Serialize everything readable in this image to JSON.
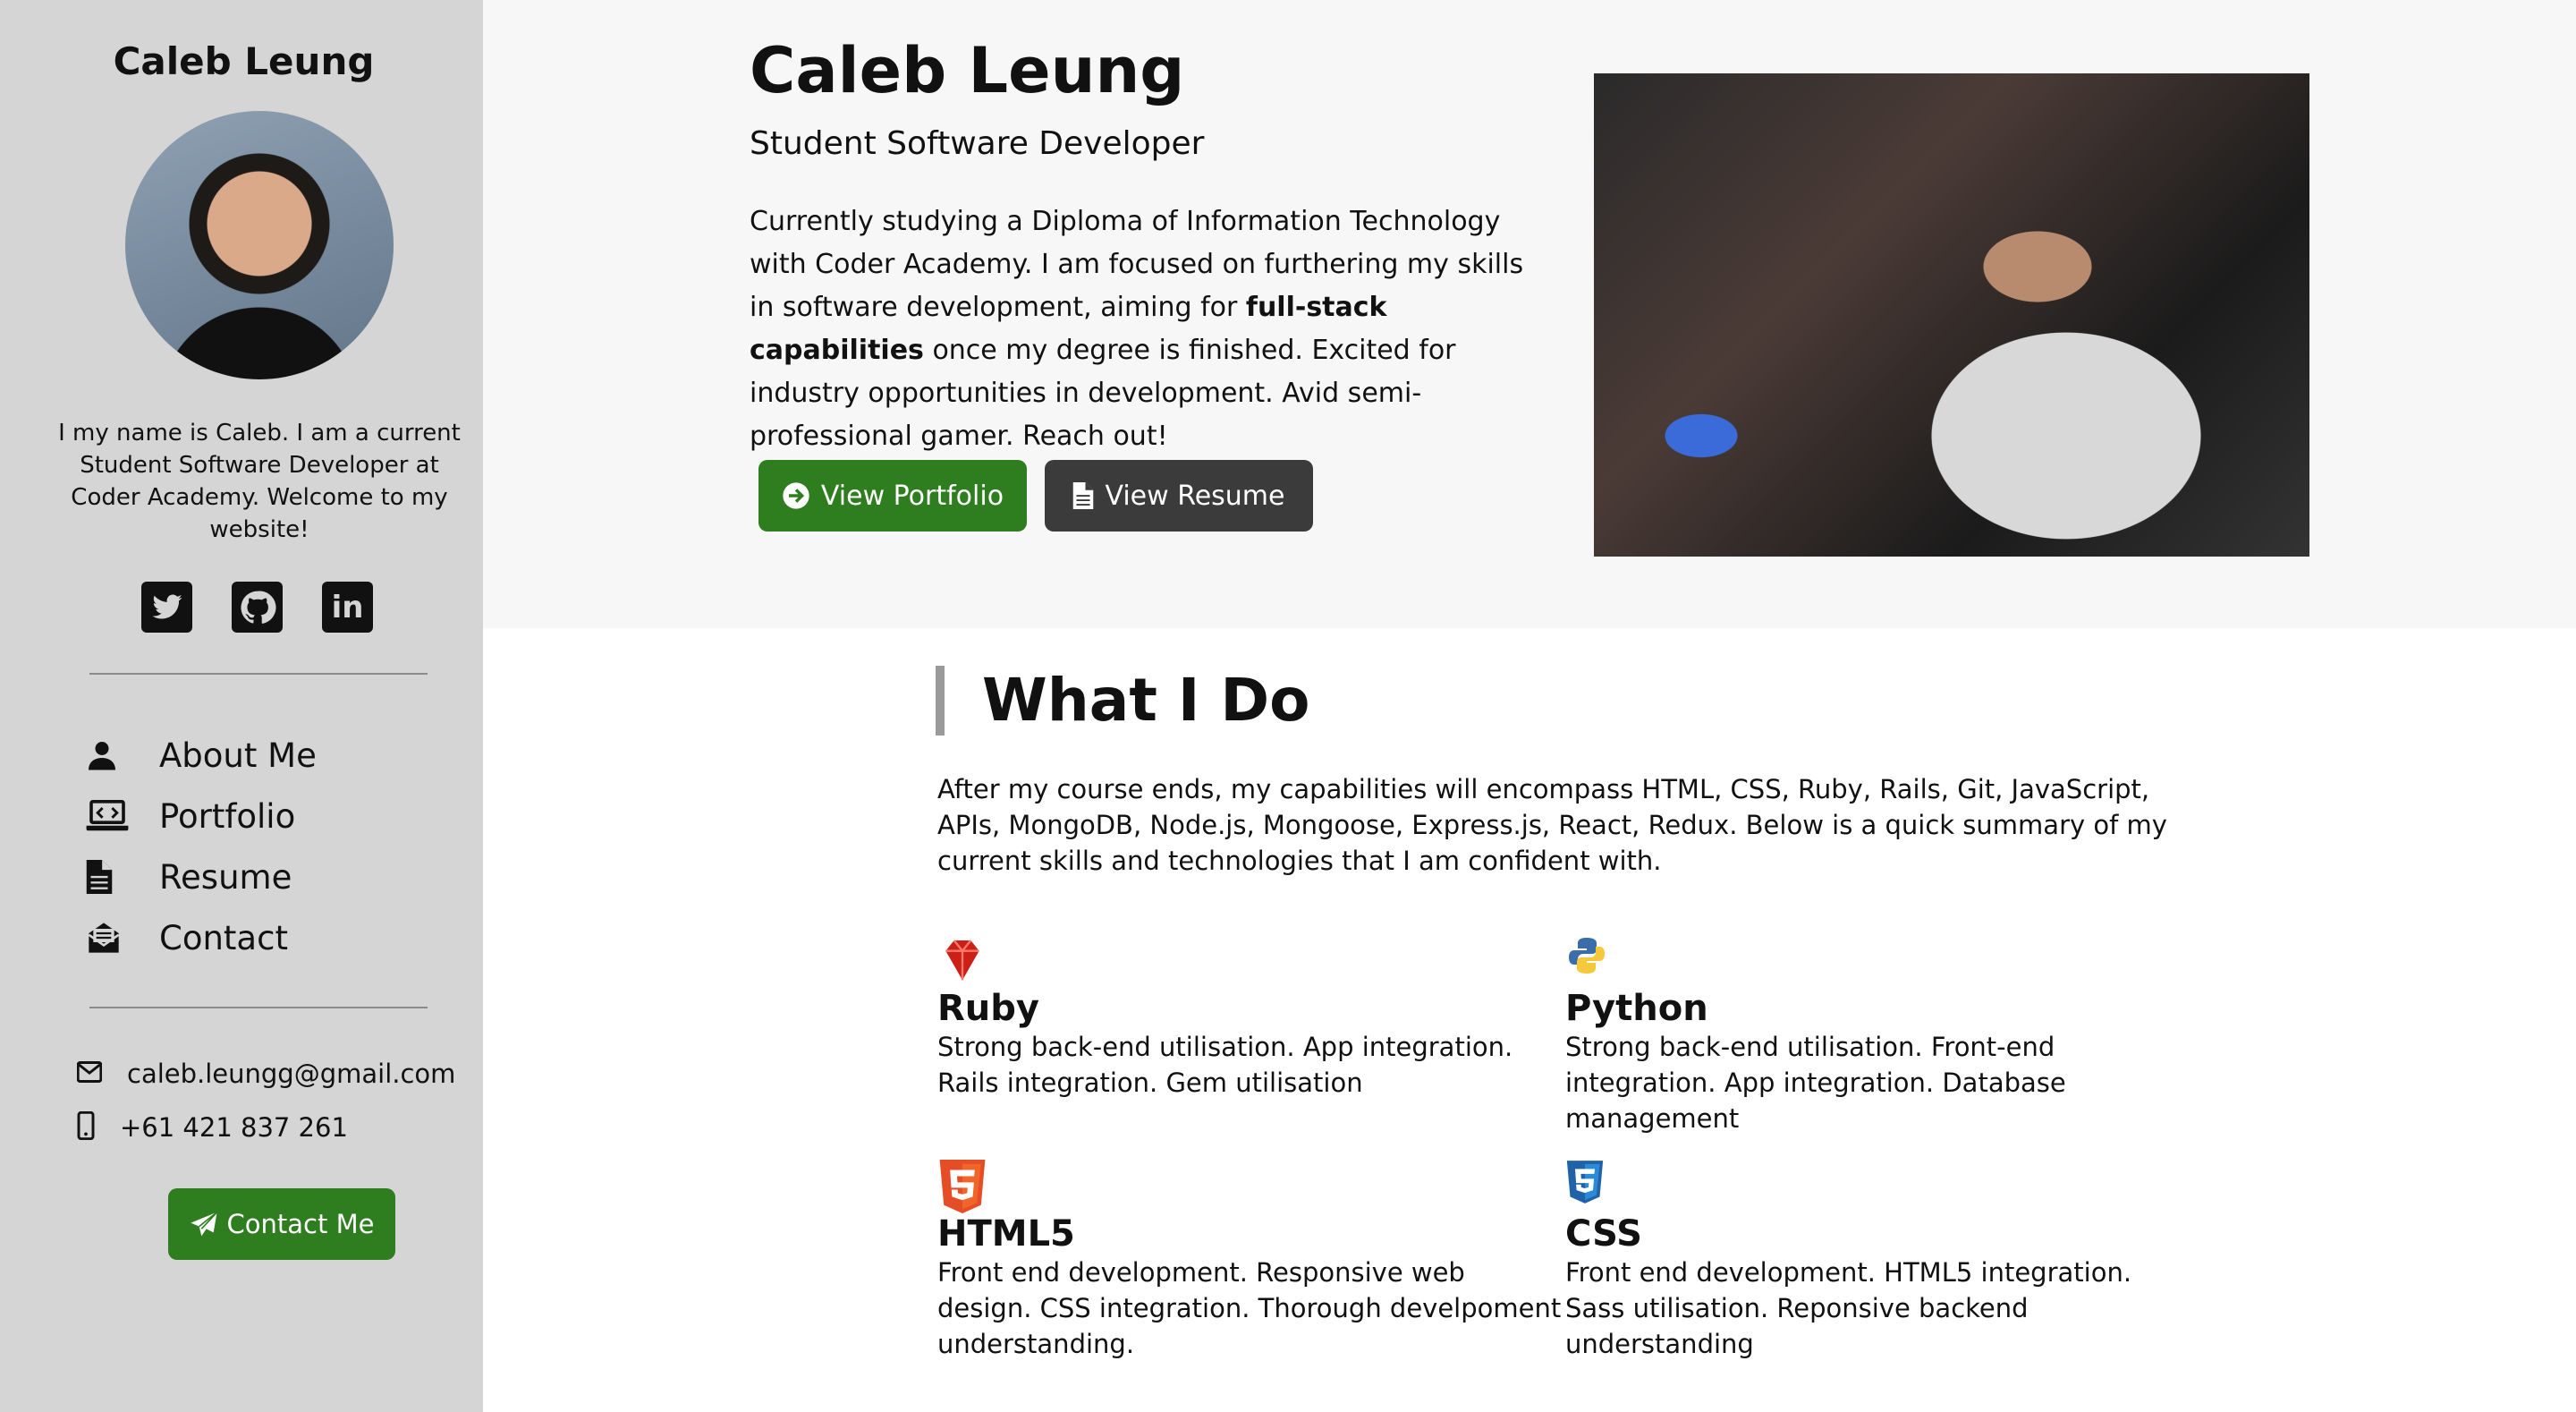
{
  "sidebar": {
    "name": "Caleb Leung",
    "intro": "I my name is Caleb. I am a current Student Software Developer at Coder Academy. Welcome to my website!",
    "social": [
      {
        "icon": "twitter-icon",
        "glyph": "🐦"
      },
      {
        "icon": "github-icon",
        "glyph": "⌂"
      },
      {
        "icon": "linkedin-icon",
        "glyph": "in"
      }
    ],
    "nav": [
      {
        "label": "About Me",
        "icon": "user-icon"
      },
      {
        "label": "Portfolio",
        "icon": "laptop-code-icon"
      },
      {
        "label": "Resume",
        "icon": "file-icon"
      },
      {
        "label": "Contact",
        "icon": "envelope-open-icon"
      }
    ],
    "email": "caleb.leungg@gmail.com",
    "phone": "+61 421 837 261",
    "contact_button": "Contact Me"
  },
  "hero": {
    "name": "Caleb Leung",
    "subtitle": "Student Software Developer",
    "desc_1": "Currently studying a Diploma of Information Technology with Coder Academy. I am focused on furthering my skills in software development, aiming for ",
    "desc_bold": "full-stack capabilities",
    "desc_2": " once my degree is finished. Excited for industry opportunities in development. Avid semi-professional gamer. Reach out!",
    "btn_portfolio": "View Portfolio",
    "btn_resume": "View Resume"
  },
  "what_i_do": {
    "title": "What I Do",
    "intro": "After my course ends, my capabilities will encompass HTML, CSS, Ruby, Rails, Git, JavaScript, APIs, MongoDB, Node.js, Mongoose, Express.js, React, Redux. Below is a quick summary of my current skills and technologies that I am confident with.",
    "skills": [
      {
        "name": "Ruby",
        "desc": "Strong back-end utilisation. App integration. Rails integration. Gem utilisation",
        "icon": "ruby-icon"
      },
      {
        "name": "Python",
        "desc": "Strong back-end utilisation. Front-end integration. App integration. Database management",
        "icon": "python-icon"
      },
      {
        "name": "HTML5",
        "desc": "Front end development. Responsive web design. CSS integration. Thorough develpoment understanding.",
        "icon": "html5-icon"
      },
      {
        "name": "CSS",
        "desc": "Front end development. HTML5 integration. Sass utilisation. Reponsive backend understanding",
        "icon": "css3-icon"
      }
    ]
  },
  "colors": {
    "green": "#2e7d1f",
    "dark_button": "#3b3b3b",
    "sidebar_bg": "#d5d5d5",
    "hero_bg": "#f7f7f7"
  }
}
